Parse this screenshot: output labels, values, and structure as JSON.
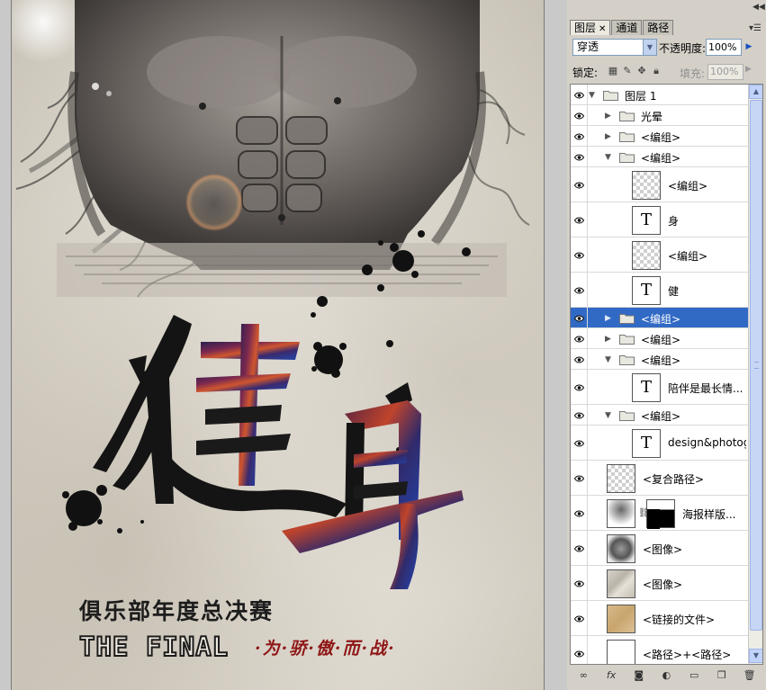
{
  "panel": {
    "tabs": [
      {
        "label": "图层",
        "active": true
      },
      {
        "label": "通道",
        "active": false
      },
      {
        "label": "路径",
        "active": false
      }
    ],
    "blend_mode": "穿透",
    "opacity_label": "不透明度:",
    "opacity_value": "100%",
    "lock_label": "锁定:",
    "fill_label": "填充:",
    "fill_value": "100%",
    "layers": [
      {
        "name": "图层 1",
        "type": "group",
        "expanded": true,
        "indent": 0
      },
      {
        "name": "光晕",
        "type": "group",
        "expanded": false,
        "indent": 1
      },
      {
        "name": "<编组>",
        "type": "group",
        "expanded": false,
        "indent": 1
      },
      {
        "name": "<编组>",
        "type": "group",
        "expanded": true,
        "indent": 1
      },
      {
        "name": "<编组>",
        "type": "checker",
        "indent": 2
      },
      {
        "name": "身",
        "type": "text",
        "indent": 2
      },
      {
        "name": "<编组>",
        "type": "checker",
        "indent": 2
      },
      {
        "name": "健",
        "type": "text",
        "indent": 2
      },
      {
        "name": "<编组>",
        "type": "group",
        "expanded": false,
        "indent": 1,
        "selected": true
      },
      {
        "name": "<编组>",
        "type": "group",
        "expanded": false,
        "indent": 1
      },
      {
        "name": "<编组>",
        "type": "group",
        "expanded": true,
        "indent": 1
      },
      {
        "name": "陪伴是最长情...",
        "type": "text",
        "indent": 2
      },
      {
        "name": "<编组>",
        "type": "group",
        "expanded": true,
        "indent": 1
      },
      {
        "name": "design&photog...",
        "type": "text",
        "indent": 2
      },
      {
        "name": "<复合路径>",
        "type": "checker",
        "indent": 1
      },
      {
        "name": "海报样版...",
        "type": "masked",
        "indent": 1
      },
      {
        "name": "<图像>",
        "type": "image-dark",
        "indent": 1
      },
      {
        "name": "<图像>",
        "type": "image-marble",
        "indent": 1
      },
      {
        "name": "<链接的文件>",
        "type": "image-paper",
        "indent": 1
      },
      {
        "name": "<路径>+<路径>",
        "type": "white",
        "indent": 1
      }
    ]
  },
  "poster": {
    "title_char_1": "健",
    "title_char_2": "身",
    "subtitle": "俱乐部年度总决赛",
    "english": "THE FINAL",
    "slogan": "·为·骄·傲·而·战·"
  }
}
